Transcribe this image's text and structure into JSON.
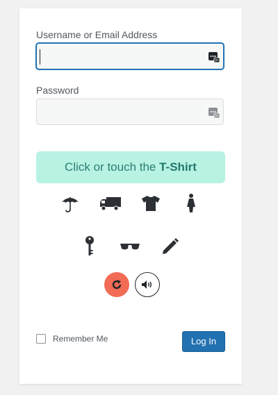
{
  "form": {
    "username_label": "Username or Email Address",
    "username_value": "",
    "password_label": "Password",
    "password_value": "",
    "captcha_prefix": "Click or touch the ",
    "captcha_target": "T-Shirt",
    "captcha_icons": [
      "umbrella-icon",
      "truck-icon",
      "tshirt-icon",
      "female-figure-icon",
      "key-icon",
      "sunglasses-icon",
      "pencil-icon"
    ],
    "remember_label": "Remember Me",
    "remember_checked": false,
    "login_label": "Log In"
  },
  "colors": {
    "accent": "#2271b1",
    "captcha_bg": "#b8f2e3",
    "captcha_text": "#2b7f73",
    "refresh": "#f26b55"
  }
}
